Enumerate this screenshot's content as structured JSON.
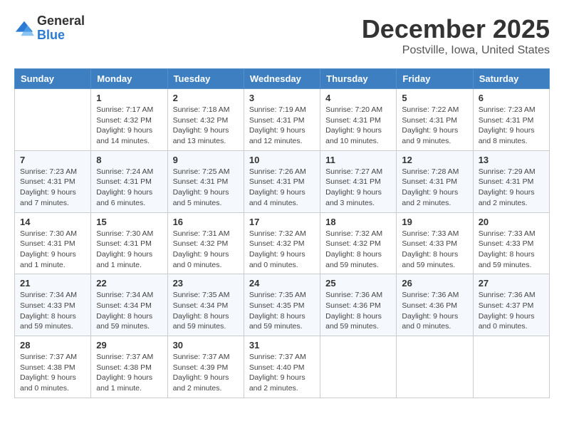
{
  "logo": {
    "general": "General",
    "blue": "Blue"
  },
  "header": {
    "month": "December 2025",
    "location": "Postville, Iowa, United States"
  },
  "weekdays": [
    "Sunday",
    "Monday",
    "Tuesday",
    "Wednesday",
    "Thursday",
    "Friday",
    "Saturday"
  ],
  "weeks": [
    [
      {
        "day": "",
        "info": ""
      },
      {
        "day": "1",
        "info": "Sunrise: 7:17 AM\nSunset: 4:32 PM\nDaylight: 9 hours\nand 14 minutes."
      },
      {
        "day": "2",
        "info": "Sunrise: 7:18 AM\nSunset: 4:32 PM\nDaylight: 9 hours\nand 13 minutes."
      },
      {
        "day": "3",
        "info": "Sunrise: 7:19 AM\nSunset: 4:31 PM\nDaylight: 9 hours\nand 12 minutes."
      },
      {
        "day": "4",
        "info": "Sunrise: 7:20 AM\nSunset: 4:31 PM\nDaylight: 9 hours\nand 10 minutes."
      },
      {
        "day": "5",
        "info": "Sunrise: 7:22 AM\nSunset: 4:31 PM\nDaylight: 9 hours\nand 9 minutes."
      },
      {
        "day": "6",
        "info": "Sunrise: 7:23 AM\nSunset: 4:31 PM\nDaylight: 9 hours\nand 8 minutes."
      }
    ],
    [
      {
        "day": "7",
        "info": "Sunrise: 7:23 AM\nSunset: 4:31 PM\nDaylight: 9 hours\nand 7 minutes."
      },
      {
        "day": "8",
        "info": "Sunrise: 7:24 AM\nSunset: 4:31 PM\nDaylight: 9 hours\nand 6 minutes."
      },
      {
        "day": "9",
        "info": "Sunrise: 7:25 AM\nSunset: 4:31 PM\nDaylight: 9 hours\nand 5 minutes."
      },
      {
        "day": "10",
        "info": "Sunrise: 7:26 AM\nSunset: 4:31 PM\nDaylight: 9 hours\nand 4 minutes."
      },
      {
        "day": "11",
        "info": "Sunrise: 7:27 AM\nSunset: 4:31 PM\nDaylight: 9 hours\nand 3 minutes."
      },
      {
        "day": "12",
        "info": "Sunrise: 7:28 AM\nSunset: 4:31 PM\nDaylight: 9 hours\nand 2 minutes."
      },
      {
        "day": "13",
        "info": "Sunrise: 7:29 AM\nSunset: 4:31 PM\nDaylight: 9 hours\nand 2 minutes."
      }
    ],
    [
      {
        "day": "14",
        "info": "Sunrise: 7:30 AM\nSunset: 4:31 PM\nDaylight: 9 hours\nand 1 minute."
      },
      {
        "day": "15",
        "info": "Sunrise: 7:30 AM\nSunset: 4:31 PM\nDaylight: 9 hours\nand 1 minute."
      },
      {
        "day": "16",
        "info": "Sunrise: 7:31 AM\nSunset: 4:32 PM\nDaylight: 9 hours\nand 0 minutes."
      },
      {
        "day": "17",
        "info": "Sunrise: 7:32 AM\nSunset: 4:32 PM\nDaylight: 9 hours\nand 0 minutes."
      },
      {
        "day": "18",
        "info": "Sunrise: 7:32 AM\nSunset: 4:32 PM\nDaylight: 8 hours\nand 59 minutes."
      },
      {
        "day": "19",
        "info": "Sunrise: 7:33 AM\nSunset: 4:33 PM\nDaylight: 8 hours\nand 59 minutes."
      },
      {
        "day": "20",
        "info": "Sunrise: 7:33 AM\nSunset: 4:33 PM\nDaylight: 8 hours\nand 59 minutes."
      }
    ],
    [
      {
        "day": "21",
        "info": "Sunrise: 7:34 AM\nSunset: 4:33 PM\nDaylight: 8 hours\nand 59 minutes."
      },
      {
        "day": "22",
        "info": "Sunrise: 7:34 AM\nSunset: 4:34 PM\nDaylight: 8 hours\nand 59 minutes."
      },
      {
        "day": "23",
        "info": "Sunrise: 7:35 AM\nSunset: 4:34 PM\nDaylight: 8 hours\nand 59 minutes."
      },
      {
        "day": "24",
        "info": "Sunrise: 7:35 AM\nSunset: 4:35 PM\nDaylight: 8 hours\nand 59 minutes."
      },
      {
        "day": "25",
        "info": "Sunrise: 7:36 AM\nSunset: 4:36 PM\nDaylight: 8 hours\nand 59 minutes."
      },
      {
        "day": "26",
        "info": "Sunrise: 7:36 AM\nSunset: 4:36 PM\nDaylight: 9 hours\nand 0 minutes."
      },
      {
        "day": "27",
        "info": "Sunrise: 7:36 AM\nSunset: 4:37 PM\nDaylight: 9 hours\nand 0 minutes."
      }
    ],
    [
      {
        "day": "28",
        "info": "Sunrise: 7:37 AM\nSunset: 4:38 PM\nDaylight: 9 hours\nand 0 minutes."
      },
      {
        "day": "29",
        "info": "Sunrise: 7:37 AM\nSunset: 4:38 PM\nDaylight: 9 hours\nand 1 minute."
      },
      {
        "day": "30",
        "info": "Sunrise: 7:37 AM\nSunset: 4:39 PM\nDaylight: 9 hours\nand 2 minutes."
      },
      {
        "day": "31",
        "info": "Sunrise: 7:37 AM\nSunset: 4:40 PM\nDaylight: 9 hours\nand 2 minutes."
      },
      {
        "day": "",
        "info": ""
      },
      {
        "day": "",
        "info": ""
      },
      {
        "day": "",
        "info": ""
      }
    ]
  ]
}
